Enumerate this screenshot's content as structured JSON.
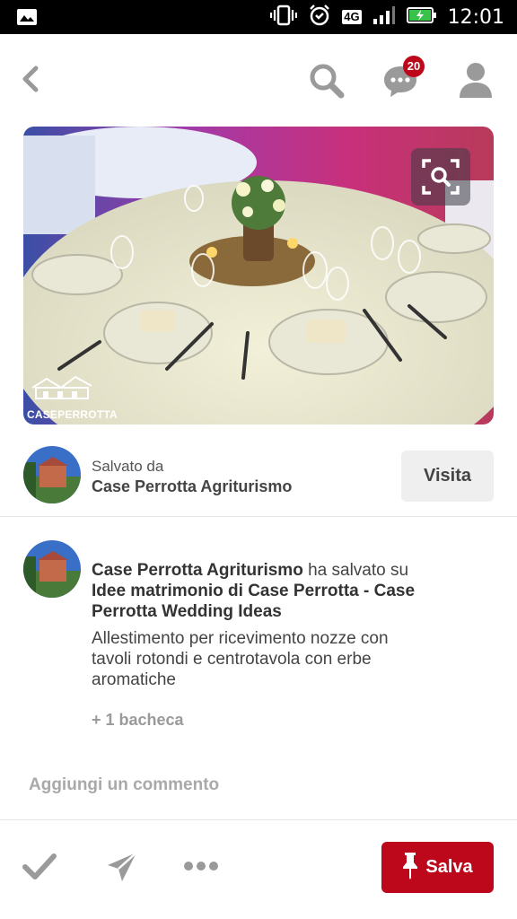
{
  "status_bar": {
    "time": "12:01",
    "network": "4G",
    "icons": [
      "image-icon",
      "vibrate-icon",
      "alarm-icon",
      "network-4g-icon",
      "signal-icon",
      "battery-charging-icon"
    ]
  },
  "header": {
    "back_icon": "chevron-left-icon",
    "search_icon": "search-icon",
    "messages_icon": "chat-bubble-icon",
    "messages_badge": "20",
    "profile_icon": "person-icon"
  },
  "pin": {
    "image_description_icon": "table-setting-photo",
    "visual_search_icon": "visual-search-icon",
    "watermark_text": "CASEPERROTTA"
  },
  "saved_by": {
    "label": "Salvato da",
    "name": "Case Perrotta Agriturismo",
    "visit_label": "Visita"
  },
  "description": {
    "user": "Case Perrotta Agriturismo",
    "action": " ha salvato su ",
    "board": "Idee matrimonio di Case Perrotta - Case Perrotta Wedding Ideas",
    "text": "Allestimento per ricevimento nozze con tavoli rotondi e centrotavola con erbe aromatiche",
    "more_boards": "+ 1 bacheca"
  },
  "comment": {
    "placeholder": "Aggiungi un commento"
  },
  "bottom_bar": {
    "check_icon": "checkmark-icon",
    "send_icon": "send-icon",
    "more_icon": "more-dots-icon",
    "save_label": "Salva",
    "save_icon": "pin-icon"
  },
  "colors": {
    "accent": "#bd081c",
    "icon_gray": "#9a9a9a",
    "visit_bg": "#efefef"
  }
}
